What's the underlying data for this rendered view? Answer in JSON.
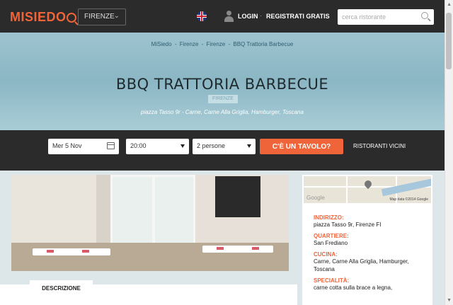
{
  "header": {
    "logo": "MISIEDO",
    "city": "FIRENZE",
    "login": "LOGIN",
    "separator": "·",
    "register": "REGISTRATI GRATIS",
    "search_placeholder": "cerca ristorante"
  },
  "hero": {
    "breadcrumb": [
      "MiSiedo",
      "Firenze",
      "Firenze",
      "BBQ Trattoria Barbecue"
    ],
    "breadcrumb_sep": "-",
    "title": "BBQ TRATTORIA BARBECUE",
    "city_badge": "FIRENZE",
    "address": "piazza Tasso 9r - Carne, Carne Alla Griglia, Hamburger, Toscana"
  },
  "booking": {
    "date": "Mer 5 Nov",
    "time": "20:00",
    "people": "2 persone",
    "cta": "C'È UN TAVOLO?",
    "nearby": "RISTORANTI VICINI"
  },
  "info": {
    "map_brand": "Google",
    "map_copyright": "Map data ©2014 Google",
    "address_label": "INDIRIZZO:",
    "address_value": "piazza Tasso 9r, Firenze FI",
    "district_label": "QUARTIERE:",
    "district_value": "San Frediano",
    "cuisine_label": "CUCINA:",
    "cuisine_value": "Carne, Carne Alla Griglia, Hamburger, Toscana",
    "specialty_label": "SPECIALITÀ:",
    "specialty_value": "carne cotta sulla brace a legna,"
  },
  "tabs": {
    "description": "DESCRIZIONE"
  },
  "colors": {
    "accent": "#f0643a",
    "topbar": "#2b2b2b",
    "hero": "#9dc3cf"
  }
}
